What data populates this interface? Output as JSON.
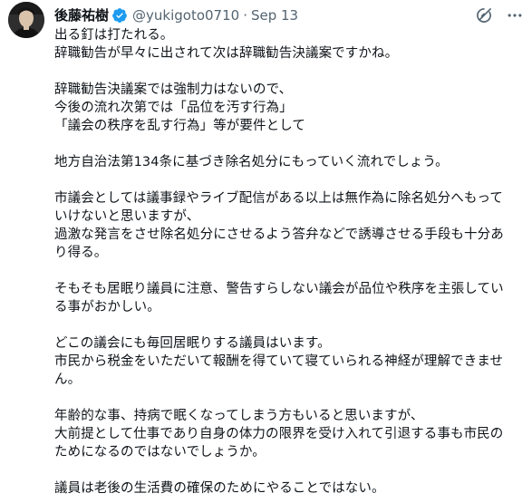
{
  "author": {
    "name": "後藤祐樹",
    "handle": "@yukigoto0710",
    "separator": "·",
    "date": "Sep 13"
  },
  "icons": {
    "avatar": "avatar-photo",
    "verified": "verified-badge-icon",
    "grok": "grok-icon",
    "more": "more-icon"
  },
  "colors": {
    "verified": "#1d9bf0",
    "secondary_text": "#536471",
    "primary_text": "#0f1419"
  },
  "body": {
    "p1": [
      "出る釘は打たれる。",
      "辞職勧告が早々に出されて次は辞職勧告決議案ですかね。"
    ],
    "p2": [
      "辞職勧告決議案では強制力はないので、",
      "今後の流れ次第では「品位を汚す行為」",
      "「議会の秩序を乱す行為」等が要件として"
    ],
    "p3": [
      "地方自治法第134条に基づき除名処分にもっていく流れでしょう。"
    ],
    "p4": [
      "市議会としては議事録やライブ配信がある以上は無作為に除名処分へもって",
      "いけないと思いますが、",
      "過激な発言をさせ除名処分にさせるよう答弁などで誘導させる手段も十分あ",
      "り得る。"
    ],
    "p5": [
      "そもそも居眠り議員に注意、警告すらしない議会が品位や秩序を主張してい",
      "る事がおかしい。"
    ],
    "p6": [
      "どこの議会にも毎回居眠りする議員はいます。",
      "市民から税金をいただいて報酬を得ていて寝ていられる神経が理解できませ",
      "ん。"
    ],
    "p7": [
      "年齢的な事、持病で眠くなってしまう方もいると思いますが、",
      "大前提として仕事であり自身の体力の限界を受け入れて引退する事も市民の",
      "ためになるのではないでしょうか。"
    ],
    "p8": [
      "議員は老後の生活費の確保のためにやることではない。"
    ]
  }
}
